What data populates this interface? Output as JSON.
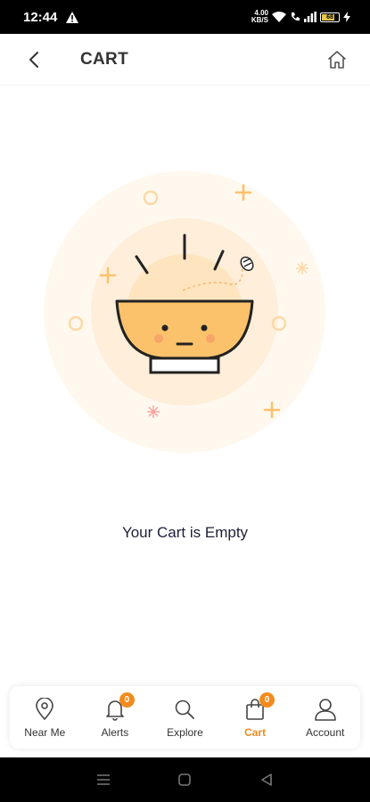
{
  "status_bar": {
    "time": "12:44",
    "speed_value": "4.00",
    "speed_unit": "KB/S",
    "battery": "68"
  },
  "header": {
    "title": "CART"
  },
  "main": {
    "empty_message": "Your Cart is Empty"
  },
  "bottom_nav": {
    "items": [
      {
        "label": "Near Me",
        "icon": "location-pin-icon"
      },
      {
        "label": "Alerts",
        "icon": "bell-icon",
        "badge": "0"
      },
      {
        "label": "Explore",
        "icon": "search-icon"
      },
      {
        "label": "Cart",
        "icon": "shopping-bag-icon",
        "badge": "0",
        "active": true
      },
      {
        "label": "Account",
        "icon": "user-icon"
      }
    ]
  },
  "colors": {
    "accent": "#f28b1e",
    "bowl": "#fcc26b",
    "glow": "#fff3e1"
  }
}
